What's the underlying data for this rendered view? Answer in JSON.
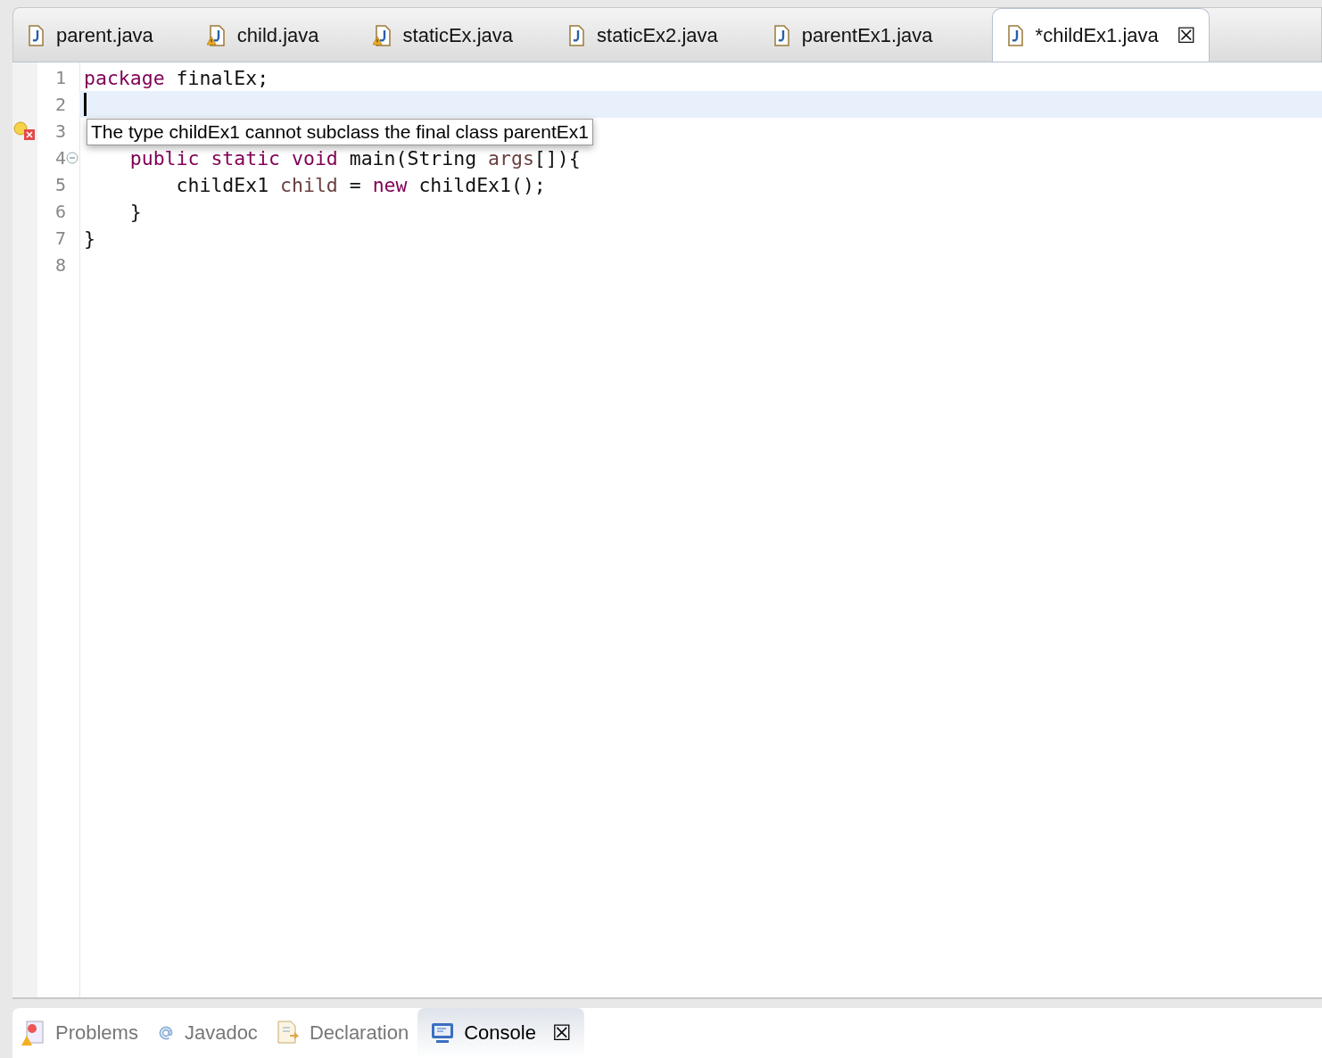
{
  "editor_tabs": [
    {
      "label": "parent.java",
      "warning": false,
      "selected": false
    },
    {
      "label": "child.java",
      "warning": true,
      "selected": false
    },
    {
      "label": "staticEx.java",
      "warning": true,
      "selected": false
    },
    {
      "label": "staticEx2.java",
      "warning": false,
      "selected": false
    },
    {
      "label": "parentEx1.java",
      "warning": false,
      "selected": false
    },
    {
      "label": "*childEx1.java",
      "warning": false,
      "selected": true,
      "close": "☒"
    }
  ],
  "code_lines": [
    {
      "number": "1",
      "current": false,
      "error": false,
      "foldable": false,
      "tokens": [
        {
          "kind": "keyword",
          "text": "package"
        },
        {
          "kind": "plain",
          "text": " finalEx;"
        }
      ]
    },
    {
      "number": "2",
      "current": true,
      "error": false,
      "foldable": false
    },
    {
      "number": "3",
      "current": false,
      "error": true,
      "foldable": false
    },
    {
      "number": "4",
      "current": false,
      "error": false,
      "foldable": true,
      "tokens": [
        {
          "kind": "keyword",
          "text": "    public static void"
        },
        {
          "kind": "plain",
          "text": " main(String "
        },
        {
          "kind": "variable",
          "text": "args"
        },
        {
          "kind": "plain",
          "text": "[]){"
        }
      ]
    },
    {
      "number": "5",
      "current": false,
      "error": false,
      "foldable": false,
      "tokens": [
        {
          "kind": "plain",
          "text": "        childEx1 "
        },
        {
          "kind": "variable",
          "text": "child"
        },
        {
          "kind": "plain",
          "text": " = "
        },
        {
          "kind": "keyword",
          "text": "new"
        },
        {
          "kind": "plain",
          "text": " childEx1();"
        }
      ]
    },
    {
      "number": "6",
      "current": false,
      "error": false,
      "foldable": false,
      "tokens": [
        {
          "kind": "plain",
          "text": "    }"
        }
      ]
    },
    {
      "number": "7",
      "current": false,
      "error": false,
      "foldable": false,
      "tokens": [
        {
          "kind": "plain",
          "text": "}"
        }
      ]
    },
    {
      "number": "8",
      "current": false,
      "error": false,
      "foldable": false
    }
  ],
  "tooltip": {
    "text": "The type childEx1 cannot subclass the final class parentEx1"
  },
  "view_tabs": [
    {
      "kind": "problems",
      "label": "Problems",
      "selected": false
    },
    {
      "kind": "javadoc",
      "label": "Javadoc",
      "selected": false
    },
    {
      "kind": "declaration",
      "label": "Declaration",
      "selected": false
    },
    {
      "kind": "console",
      "label": "Console",
      "selected": true,
      "close": "☒"
    }
  ]
}
